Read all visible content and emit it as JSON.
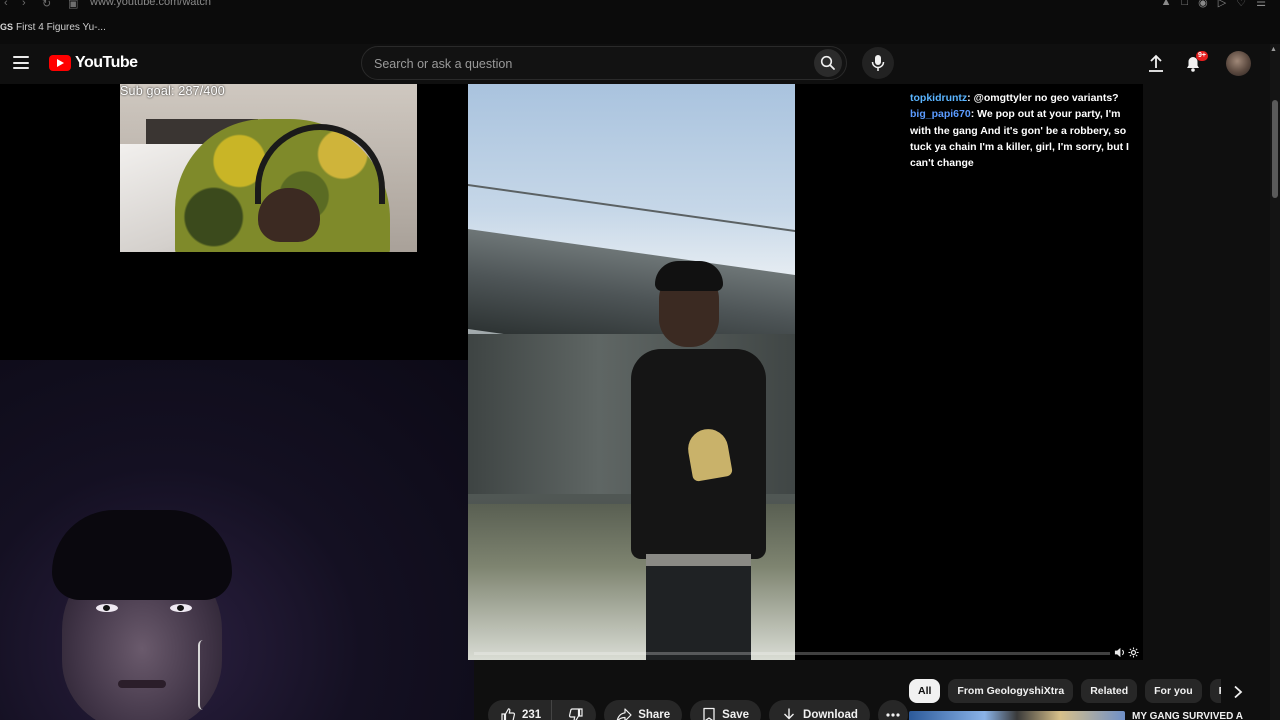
{
  "browser": {
    "url": "www.youtube.com/watch",
    "tab_favicon": "GS",
    "tab_title": "First 4 Figures Yu-..."
  },
  "header": {
    "logo_text": "YouTube",
    "search_placeholder": "Search or ask a question",
    "notification_badge": "9+"
  },
  "video": {
    "overlay_text": "Sub goal: 287/400",
    "progress_fraction": 0.0,
    "chat": [
      {
        "user": "topkidruntz",
        "sep": ": ",
        "message": "@omgttyler no geo variants?"
      },
      {
        "user": "big_papi670",
        "sep": ": ",
        "message": "We pop out at your party, I'm with the gang And it's gon' be a robbery, so tuck ya chain I'm a killer, girl, I'm sorry, but I can't change"
      }
    ]
  },
  "actions": {
    "like_count": "231",
    "share_label": "Share",
    "save_label": "Save",
    "download_label": "Download"
  },
  "chips": [
    "All",
    "From GeologyshiXtra",
    "Related",
    "For you",
    "Re"
  ],
  "recommendation": {
    "title": "MY GANG SURVIVED A"
  },
  "colors": {
    "accent": "#ff0000",
    "background": "#0f0f0f",
    "chat_user": "#5ab4ff"
  },
  "icons": [
    "back-icon",
    "forward-icon",
    "reload-icon",
    "menu-icon",
    "search-icon",
    "mic-icon",
    "upload-icon",
    "bell-icon",
    "like-icon",
    "dislike-icon",
    "share-icon",
    "save-icon",
    "download-icon",
    "more-icon",
    "chevron-right-icon",
    "volume-icon",
    "settings-icon"
  ]
}
